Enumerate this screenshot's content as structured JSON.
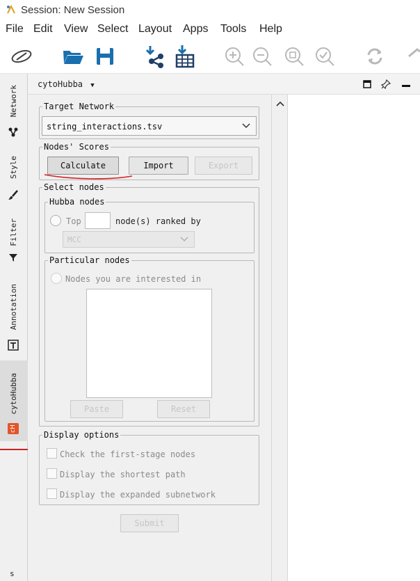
{
  "window": {
    "title": "Session: New Session"
  },
  "menu": [
    "File",
    "Edit",
    "View",
    "Select",
    "Layout",
    "Apps",
    "Tools",
    "Help"
  ],
  "toolbar": {
    "icons": [
      "cytoscape-logo-icon",
      "open-folder-icon",
      "save-icon",
      "import-network-icon",
      "import-table-icon",
      "zoom-in-icon",
      "zoom-out-icon",
      "zoom-fit-icon",
      "zoom-selected-icon",
      "refresh-icon",
      "home-icon"
    ]
  },
  "left_tabs": {
    "network": "Network",
    "style": "Style",
    "filter": "Filter",
    "annotation": "Annotation",
    "cytohubba": "cytoHubba",
    "cytohubba_badge": "cH",
    "bottom": "s"
  },
  "panel": {
    "title": "cytoHubba",
    "target_network": {
      "legend": "Target Network",
      "selected": "string_interactions.tsv"
    },
    "nodes_scores": {
      "legend": "Nodes' Scores",
      "calculate": "Calculate",
      "import": "Import",
      "export": "Export"
    },
    "select_nodes": {
      "legend": "Select nodes",
      "hubba": {
        "legend": "Hubba nodes",
        "top_label": "Top",
        "top_value": "",
        "ranked_label": "node(s) ranked by",
        "method": "MCC"
      },
      "particular": {
        "legend": "Particular nodes",
        "radio_label": "Nodes you are interested in",
        "paste": "Paste",
        "reset": "Reset"
      }
    },
    "display_options": {
      "legend": "Display options",
      "first_stage": "Check the first-stage nodes",
      "shortest_path": "Display the shortest path",
      "expanded_subnetwork": "Display the expanded subnetwork"
    },
    "submit": "Submit"
  },
  "colors": {
    "accent_red": "#d42020",
    "toolbar_blue": "#1a6fae",
    "disabled_icon": "#b8b8b8"
  }
}
